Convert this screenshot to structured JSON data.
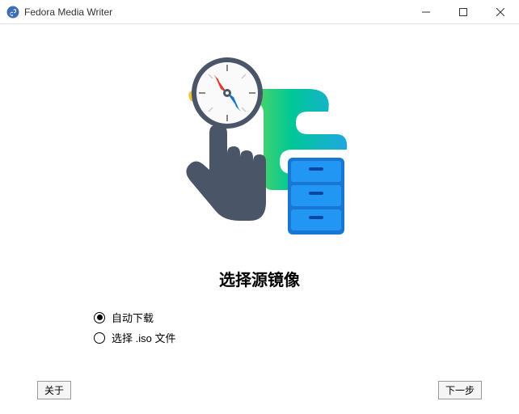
{
  "window": {
    "title": "Fedora Media Writer"
  },
  "main": {
    "heading": "选择源镜像"
  },
  "options": {
    "auto_download": "自动下载",
    "select_iso": "选择 .iso 文件",
    "selected": "auto_download"
  },
  "footer": {
    "about": "关于",
    "next": "下一步"
  }
}
